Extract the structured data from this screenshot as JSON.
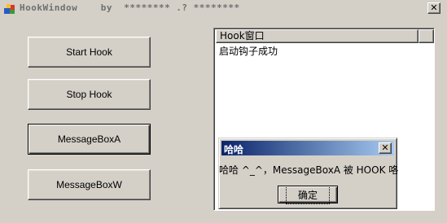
{
  "window": {
    "title": "HookWindow    by  ******** .? ********",
    "close_glyph": "✕"
  },
  "buttons": {
    "start_hook": "Start Hook",
    "stop_hook": "Stop Hook",
    "messagebox_a": "MessageBoxA",
    "messagebox_w": "MessageBoxW"
  },
  "listview": {
    "column_header": "Hook窗口",
    "rows": [
      "启动钩子成功"
    ]
  },
  "messagebox": {
    "title": "哈哈",
    "text": "哈哈 ^_^，MessageBoxA 被 HOOK 咯",
    "ok_label": "确定",
    "close_glyph": "✕"
  },
  "colors": {
    "face": "#d4d0c8",
    "active_title_start": "#0a246a",
    "active_title_end": "#a6caf0"
  }
}
